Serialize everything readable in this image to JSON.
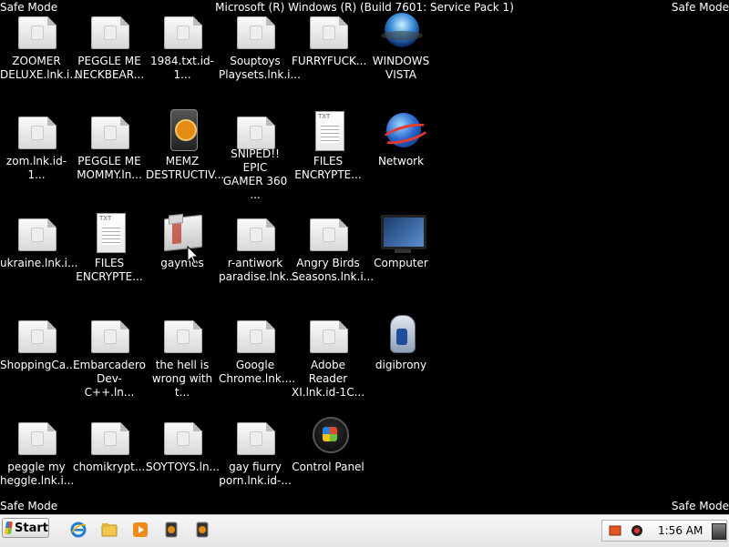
{
  "overlay": {
    "safe_mode": "Safe Mode",
    "title": "Microsoft (R) Windows (R) (Build 7601: Service Pack 1)"
  },
  "desktop": {
    "icons": [
      {
        "label": "ZOOMER\nDELUXE.lnk.i...",
        "icon": "file-icon"
      },
      {
        "label": "PEGGLE ME\nNECKBEAR...",
        "icon": "file-icon"
      },
      {
        "label": "1984.txt.id-1...",
        "icon": "file-icon"
      },
      {
        "label": "Souptoys\nPlaysets.lnk.i...",
        "icon": "file-icon"
      },
      {
        "label": "FURRYFUCK...",
        "icon": "file-icon"
      },
      {
        "label": "WINDOWS\nVISTA",
        "icon": "vista-sphere-icon"
      },
      {
        "label": "zom.lnk.id-1...",
        "icon": "file-icon"
      },
      {
        "label": "PEGGLE ME\nMOMMY.ln...",
        "icon": "file-icon"
      },
      {
        "label": "MEMZ\nDESTRUCTIV...",
        "icon": "memz-icon"
      },
      {
        "label": "SNIPED!! EPIC\nGAMER 360 ...",
        "icon": "file-icon"
      },
      {
        "label": "FILES\nENCRYPTE...",
        "icon": "text-document-icon"
      },
      {
        "label": "Network",
        "icon": "network-globe-icon"
      },
      {
        "label": "ukraine.lnk.i...",
        "icon": "file-icon"
      },
      {
        "label": "FILES\nENCRYPTE...",
        "icon": "text-document-icon"
      },
      {
        "label": "gaymes",
        "icon": "folder-icon"
      },
      {
        "label": "r-antiwork\nparadise.lnk....",
        "icon": "file-icon"
      },
      {
        "label": "Angry Birds\nSeasons.lnk.i...",
        "icon": "file-icon"
      },
      {
        "label": "Computer",
        "icon": "computer-icon"
      },
      {
        "label": "ShoppingCa...",
        "icon": "file-icon"
      },
      {
        "label": "Embarcadero\nDev-C++.ln...",
        "icon": "file-icon"
      },
      {
        "label": "the hell is\nwrong with t...",
        "icon": "file-icon"
      },
      {
        "label": "Google\nChrome.lnk....",
        "icon": "file-icon"
      },
      {
        "label": "Adobe Reader\nXI.lnk.id-1C...",
        "icon": "file-icon"
      },
      {
        "label": "digibrony",
        "icon": "digibrony-icon"
      },
      {
        "label": "peggle my\nheggle.lnk.i...",
        "icon": "file-icon"
      },
      {
        "label": "chomikrypt....",
        "icon": "file-icon"
      },
      {
        "label": "SOYTOYS.ln...",
        "icon": "file-icon"
      },
      {
        "label": "gay fiurry\nporn.lnk.id-...",
        "icon": "file-icon"
      },
      {
        "label": "Control Panel",
        "icon": "control-panel-icon"
      }
    ]
  },
  "taskbar": {
    "start_label": "Start",
    "quick_launch": [
      "internet-explorer-icon",
      "windows-explorer-icon",
      "media-player-icon",
      "memz-icon",
      "memz-icon"
    ],
    "tray_icons": [
      "action-center-icon",
      "security-alert-icon"
    ],
    "clock": "1:56 AM"
  },
  "colors": {
    "desktop_background": "#000000",
    "taskbar": "#efefef",
    "text": "#ffffff"
  }
}
